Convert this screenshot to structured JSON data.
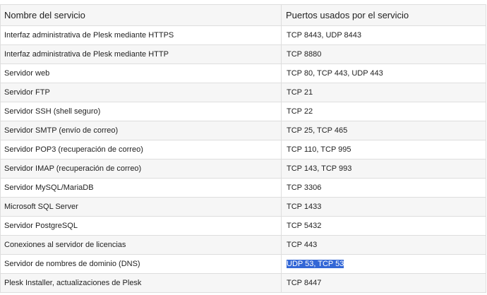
{
  "table": {
    "headers": {
      "service": "Nombre del servicio",
      "ports": "Puertos usados por el servicio"
    },
    "rows": [
      {
        "service": "Interfaz administrativa de Plesk mediante HTTPS",
        "ports": "TCP 8443, UDP 8443"
      },
      {
        "service": "Interfaz administrativa de Plesk mediante HTTP",
        "ports": "TCP 8880"
      },
      {
        "service": "Servidor web",
        "ports": "TCP 80, TCP 443, UDP 443"
      },
      {
        "service": "Servidor FTP",
        "ports": "TCP 21"
      },
      {
        "service": "Servidor SSH (shell seguro)",
        "ports": "TCP 22"
      },
      {
        "service": "Servidor SMTP (envío de correo)",
        "ports": "TCP 25, TCP 465"
      },
      {
        "service": "Servidor POP3 (recuperación de correo)",
        "ports": "TCP 110, TCP 995"
      },
      {
        "service": "Servidor IMAP (recuperación de correo)",
        "ports": "TCP 143, TCP 993"
      },
      {
        "service": "Servidor MySQL/MariaDB",
        "ports": "TCP 3306"
      },
      {
        "service": "Microsoft SQL Server",
        "ports": "TCP 1433"
      },
      {
        "service": "Servidor PostgreSQL",
        "ports": "TCP 5432"
      },
      {
        "service": "Conexiones al servidor de licencias",
        "ports": "TCP 443"
      },
      {
        "service": "Servidor de nombres de dominio (DNS)",
        "ports": "UDP 53, TCP 53",
        "selected": true
      },
      {
        "service": "Plesk Installer, actualizaciones de Plesk",
        "ports": "TCP 8447"
      }
    ]
  },
  "colors": {
    "selection": "#3367d6",
    "stripe": "#f6f6f6",
    "border": "#dedede"
  }
}
